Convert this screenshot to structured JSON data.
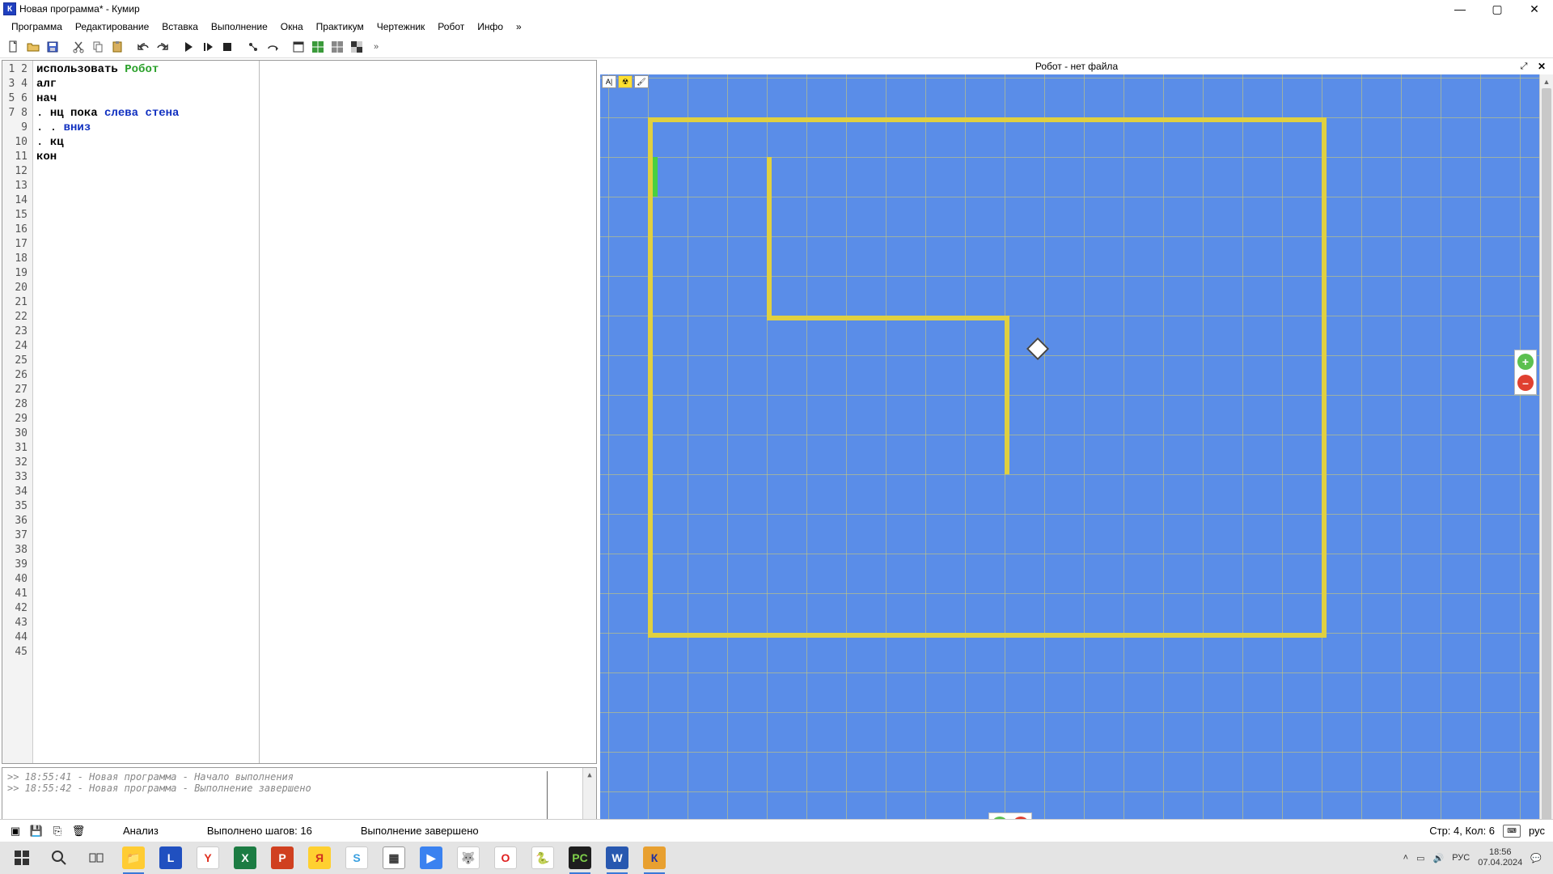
{
  "window": {
    "title": "Новая программа* - Кумир",
    "app_icon_letter": "К"
  },
  "menu": [
    "Программа",
    "Редактирование",
    "Вставка",
    "Выполнение",
    "Окна",
    "Практикум",
    "Чертежник",
    "Робот",
    "Инфо",
    "»"
  ],
  "code": {
    "lines": [
      {
        "n": 1,
        "html": "<span class='kw'>использовать</span> <span class='robot'>Робот</span>"
      },
      {
        "n": 2,
        "html": "<span class='kw'>алг</span>"
      },
      {
        "n": 3,
        "html": "<span class='kw'>нач</span>"
      },
      {
        "n": 4,
        "html": ". <span class='kw'>нц пока</span> <span class='cmd'>слева стена</span>"
      },
      {
        "n": 5,
        "html": ". . <span class='cmd'>вниз</span>"
      },
      {
        "n": 6,
        "html": ". <span class='kw'>кц</span>"
      },
      {
        "n": 7,
        "html": "<span class='kw'>кон</span>"
      },
      {
        "n": 8,
        "html": ""
      }
    ],
    "max_gutter": 45
  },
  "console": [
    ">> 18:55:41 - Новая программа - Начало выполнения",
    ">> 18:55:42 - Новая программа - Выполнение завершено"
  ],
  "robot_panel": {
    "title": "Робот - нет файла"
  },
  "status": {
    "analysis": "Анализ",
    "steps": "Выполнено шагов: 16",
    "state": "Выполнение завершено",
    "pos": "Стр: 4, Кол: 6"
  },
  "tray": {
    "lang": "РУС",
    "lang2": "рус",
    "time": "18:56",
    "date": "07.04.2024"
  }
}
